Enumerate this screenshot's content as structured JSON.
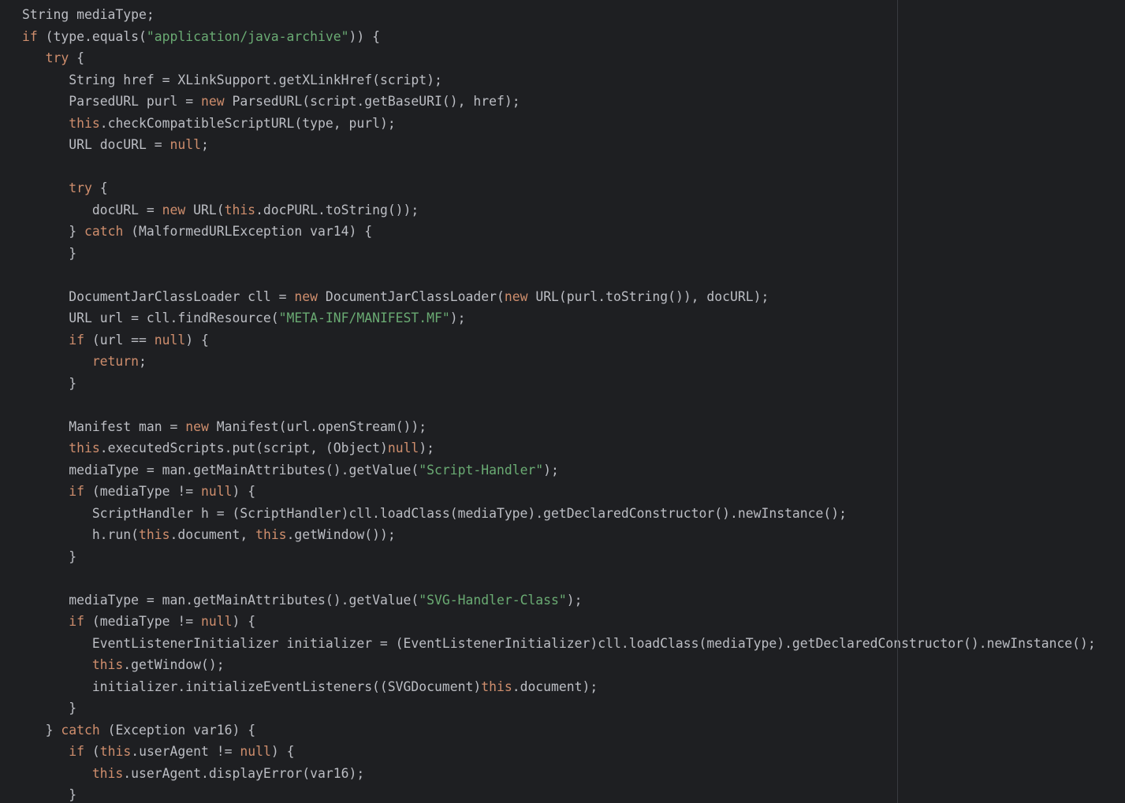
{
  "editor": {
    "colors": {
      "background": "#1e1f22",
      "default_text": "#bcbec4",
      "keyword": "#cf8e6d",
      "string": "#6aab73",
      "right_margin_guide": "#393b40"
    },
    "lines": [
      {
        "indent": 0,
        "tokens": [
          {
            "k": "txt",
            "t": "String mediaType;"
          }
        ]
      },
      {
        "indent": 0,
        "tokens": [
          {
            "k": "kw",
            "t": "if"
          },
          {
            "k": "txt",
            "t": " (type.equals("
          },
          {
            "k": "str",
            "t": "\"application/java-archive\""
          },
          {
            "k": "txt",
            "t": ")) {"
          }
        ]
      },
      {
        "indent": 1,
        "tokens": [
          {
            "k": "kw",
            "t": "try"
          },
          {
            "k": "txt",
            "t": " {"
          }
        ]
      },
      {
        "indent": 2,
        "tokens": [
          {
            "k": "txt",
            "t": "String href = XLinkSupport.getXLinkHref(script);"
          }
        ]
      },
      {
        "indent": 2,
        "tokens": [
          {
            "k": "txt",
            "t": "ParsedURL purl = "
          },
          {
            "k": "kw",
            "t": "new"
          },
          {
            "k": "txt",
            "t": " ParsedURL(script.getBaseURI(), href);"
          }
        ]
      },
      {
        "indent": 2,
        "tokens": [
          {
            "k": "kw",
            "t": "this"
          },
          {
            "k": "txt",
            "t": ".checkCompatibleScriptURL(type, purl);"
          }
        ]
      },
      {
        "indent": 2,
        "tokens": [
          {
            "k": "txt",
            "t": "URL docURL = "
          },
          {
            "k": "kw",
            "t": "null"
          },
          {
            "k": "txt",
            "t": ";"
          }
        ]
      },
      {
        "indent": 0,
        "tokens": []
      },
      {
        "indent": 2,
        "tokens": [
          {
            "k": "kw",
            "t": "try"
          },
          {
            "k": "txt",
            "t": " {"
          }
        ]
      },
      {
        "indent": 3,
        "tokens": [
          {
            "k": "txt",
            "t": "docURL = "
          },
          {
            "k": "kw",
            "t": "new"
          },
          {
            "k": "txt",
            "t": " URL("
          },
          {
            "k": "kw",
            "t": "this"
          },
          {
            "k": "txt",
            "t": ".docPURL.toString());"
          }
        ]
      },
      {
        "indent": 2,
        "tokens": [
          {
            "k": "txt",
            "t": "} "
          },
          {
            "k": "kw",
            "t": "catch"
          },
          {
            "k": "txt",
            "t": " (MalformedURLException var14) {"
          }
        ]
      },
      {
        "indent": 2,
        "tokens": [
          {
            "k": "txt",
            "t": "}"
          }
        ]
      },
      {
        "indent": 0,
        "tokens": []
      },
      {
        "indent": 2,
        "tokens": [
          {
            "k": "txt",
            "t": "DocumentJarClassLoader cll = "
          },
          {
            "k": "kw",
            "t": "new"
          },
          {
            "k": "txt",
            "t": " DocumentJarClassLoader("
          },
          {
            "k": "kw",
            "t": "new"
          },
          {
            "k": "txt",
            "t": " URL(purl.toString()), docURL);"
          }
        ]
      },
      {
        "indent": 2,
        "tokens": [
          {
            "k": "txt",
            "t": "URL url = cll.findResource("
          },
          {
            "k": "str",
            "t": "\"META-INF/MANIFEST.MF\""
          },
          {
            "k": "txt",
            "t": ");"
          }
        ]
      },
      {
        "indent": 2,
        "tokens": [
          {
            "k": "kw",
            "t": "if"
          },
          {
            "k": "txt",
            "t": " (url == "
          },
          {
            "k": "kw",
            "t": "null"
          },
          {
            "k": "txt",
            "t": ") {"
          }
        ]
      },
      {
        "indent": 3,
        "tokens": [
          {
            "k": "kw",
            "t": "return"
          },
          {
            "k": "txt",
            "t": ";"
          }
        ]
      },
      {
        "indent": 2,
        "tokens": [
          {
            "k": "txt",
            "t": "}"
          }
        ]
      },
      {
        "indent": 0,
        "tokens": []
      },
      {
        "indent": 2,
        "tokens": [
          {
            "k": "txt",
            "t": "Manifest man = "
          },
          {
            "k": "kw",
            "t": "new"
          },
          {
            "k": "txt",
            "t": " Manifest(url.openStream());"
          }
        ]
      },
      {
        "indent": 2,
        "tokens": [
          {
            "k": "kw",
            "t": "this"
          },
          {
            "k": "txt",
            "t": ".executedScripts.put(script, (Object)"
          },
          {
            "k": "kw",
            "t": "null"
          },
          {
            "k": "txt",
            "t": ");"
          }
        ]
      },
      {
        "indent": 2,
        "tokens": [
          {
            "k": "txt",
            "t": "mediaType = man.getMainAttributes().getValue("
          },
          {
            "k": "str",
            "t": "\"Script-Handler\""
          },
          {
            "k": "txt",
            "t": ");"
          }
        ]
      },
      {
        "indent": 2,
        "tokens": [
          {
            "k": "kw",
            "t": "if"
          },
          {
            "k": "txt",
            "t": " (mediaType != "
          },
          {
            "k": "kw",
            "t": "null"
          },
          {
            "k": "txt",
            "t": ") {"
          }
        ]
      },
      {
        "indent": 3,
        "tokens": [
          {
            "k": "txt",
            "t": "ScriptHandler h = (ScriptHandler)cll.loadClass(mediaType).getDeclaredConstructor().newInstance();"
          }
        ]
      },
      {
        "indent": 3,
        "tokens": [
          {
            "k": "txt",
            "t": "h.run("
          },
          {
            "k": "kw",
            "t": "this"
          },
          {
            "k": "txt",
            "t": ".document, "
          },
          {
            "k": "kw",
            "t": "this"
          },
          {
            "k": "txt",
            "t": ".getWindow());"
          }
        ]
      },
      {
        "indent": 2,
        "tokens": [
          {
            "k": "txt",
            "t": "}"
          }
        ]
      },
      {
        "indent": 0,
        "tokens": []
      },
      {
        "indent": 2,
        "tokens": [
          {
            "k": "txt",
            "t": "mediaType = man.getMainAttributes().getValue("
          },
          {
            "k": "str",
            "t": "\"SVG-Handler-Class\""
          },
          {
            "k": "txt",
            "t": ");"
          }
        ]
      },
      {
        "indent": 2,
        "tokens": [
          {
            "k": "kw",
            "t": "if"
          },
          {
            "k": "txt",
            "t": " (mediaType != "
          },
          {
            "k": "kw",
            "t": "null"
          },
          {
            "k": "txt",
            "t": ") {"
          }
        ]
      },
      {
        "indent": 3,
        "tokens": [
          {
            "k": "txt",
            "t": "EventListenerInitializer initializer = (EventListenerInitializer)cll.loadClass(mediaType).getDeclaredConstructor().newInstance();"
          }
        ]
      },
      {
        "indent": 3,
        "tokens": [
          {
            "k": "kw",
            "t": "this"
          },
          {
            "k": "txt",
            "t": ".getWindow();"
          }
        ]
      },
      {
        "indent": 3,
        "tokens": [
          {
            "k": "txt",
            "t": "initializer.initializeEventListeners((SVGDocument)"
          },
          {
            "k": "kw",
            "t": "this"
          },
          {
            "k": "txt",
            "t": ".document);"
          }
        ]
      },
      {
        "indent": 2,
        "tokens": [
          {
            "k": "txt",
            "t": "}"
          }
        ]
      },
      {
        "indent": 1,
        "tokens": [
          {
            "k": "txt",
            "t": "} "
          },
          {
            "k": "kw",
            "t": "catch"
          },
          {
            "k": "txt",
            "t": " (Exception var16) {"
          }
        ]
      },
      {
        "indent": 2,
        "tokens": [
          {
            "k": "kw",
            "t": "if"
          },
          {
            "k": "txt",
            "t": " ("
          },
          {
            "k": "kw",
            "t": "this"
          },
          {
            "k": "txt",
            "t": ".userAgent != "
          },
          {
            "k": "kw",
            "t": "null"
          },
          {
            "k": "txt",
            "t": ") {"
          }
        ]
      },
      {
        "indent": 3,
        "tokens": [
          {
            "k": "kw",
            "t": "this"
          },
          {
            "k": "txt",
            "t": ".userAgent.displayError(var16);"
          }
        ]
      },
      {
        "indent": 2,
        "tokens": [
          {
            "k": "txt",
            "t": "}"
          }
        ]
      }
    ]
  }
}
